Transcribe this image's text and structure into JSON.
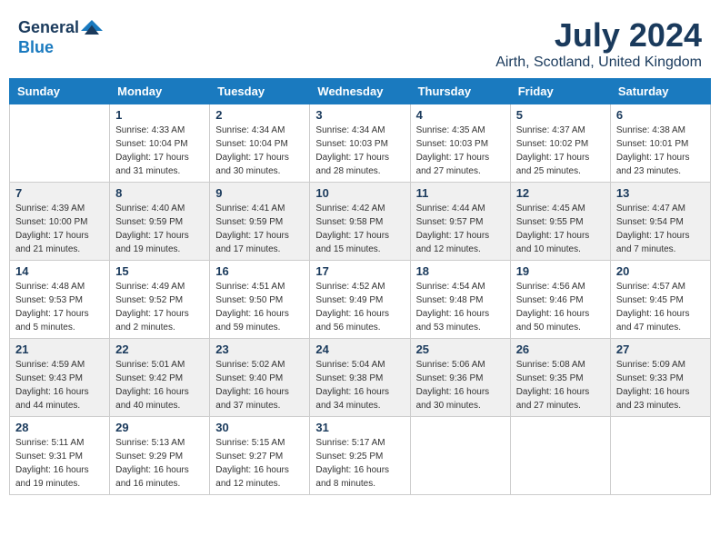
{
  "header": {
    "logo_general": "General",
    "logo_blue": "Blue",
    "month_year": "July 2024",
    "location": "Airth, Scotland, United Kingdom"
  },
  "calendar": {
    "days_of_week": [
      "Sunday",
      "Monday",
      "Tuesday",
      "Wednesday",
      "Thursday",
      "Friday",
      "Saturday"
    ],
    "weeks": [
      [
        {
          "day": "",
          "sunrise": "",
          "sunset": "",
          "daylight": ""
        },
        {
          "day": "1",
          "sunrise": "Sunrise: 4:33 AM",
          "sunset": "Sunset: 10:04 PM",
          "daylight": "Daylight: 17 hours and 31 minutes."
        },
        {
          "day": "2",
          "sunrise": "Sunrise: 4:34 AM",
          "sunset": "Sunset: 10:04 PM",
          "daylight": "Daylight: 17 hours and 30 minutes."
        },
        {
          "day": "3",
          "sunrise": "Sunrise: 4:34 AM",
          "sunset": "Sunset: 10:03 PM",
          "daylight": "Daylight: 17 hours and 28 minutes."
        },
        {
          "day": "4",
          "sunrise": "Sunrise: 4:35 AM",
          "sunset": "Sunset: 10:03 PM",
          "daylight": "Daylight: 17 hours and 27 minutes."
        },
        {
          "day": "5",
          "sunrise": "Sunrise: 4:37 AM",
          "sunset": "Sunset: 10:02 PM",
          "daylight": "Daylight: 17 hours and 25 minutes."
        },
        {
          "day": "6",
          "sunrise": "Sunrise: 4:38 AM",
          "sunset": "Sunset: 10:01 PM",
          "daylight": "Daylight: 17 hours and 23 minutes."
        }
      ],
      [
        {
          "day": "7",
          "sunrise": "Sunrise: 4:39 AM",
          "sunset": "Sunset: 10:00 PM",
          "daylight": "Daylight: 17 hours and 21 minutes."
        },
        {
          "day": "8",
          "sunrise": "Sunrise: 4:40 AM",
          "sunset": "Sunset: 9:59 PM",
          "daylight": "Daylight: 17 hours and 19 minutes."
        },
        {
          "day": "9",
          "sunrise": "Sunrise: 4:41 AM",
          "sunset": "Sunset: 9:59 PM",
          "daylight": "Daylight: 17 hours and 17 minutes."
        },
        {
          "day": "10",
          "sunrise": "Sunrise: 4:42 AM",
          "sunset": "Sunset: 9:58 PM",
          "daylight": "Daylight: 17 hours and 15 minutes."
        },
        {
          "day": "11",
          "sunrise": "Sunrise: 4:44 AM",
          "sunset": "Sunset: 9:57 PM",
          "daylight": "Daylight: 17 hours and 12 minutes."
        },
        {
          "day": "12",
          "sunrise": "Sunrise: 4:45 AM",
          "sunset": "Sunset: 9:55 PM",
          "daylight": "Daylight: 17 hours and 10 minutes."
        },
        {
          "day": "13",
          "sunrise": "Sunrise: 4:47 AM",
          "sunset": "Sunset: 9:54 PM",
          "daylight": "Daylight: 17 hours and 7 minutes."
        }
      ],
      [
        {
          "day": "14",
          "sunrise": "Sunrise: 4:48 AM",
          "sunset": "Sunset: 9:53 PM",
          "daylight": "Daylight: 17 hours and 5 minutes."
        },
        {
          "day": "15",
          "sunrise": "Sunrise: 4:49 AM",
          "sunset": "Sunset: 9:52 PM",
          "daylight": "Daylight: 17 hours and 2 minutes."
        },
        {
          "day": "16",
          "sunrise": "Sunrise: 4:51 AM",
          "sunset": "Sunset: 9:50 PM",
          "daylight": "Daylight: 16 hours and 59 minutes."
        },
        {
          "day": "17",
          "sunrise": "Sunrise: 4:52 AM",
          "sunset": "Sunset: 9:49 PM",
          "daylight": "Daylight: 16 hours and 56 minutes."
        },
        {
          "day": "18",
          "sunrise": "Sunrise: 4:54 AM",
          "sunset": "Sunset: 9:48 PM",
          "daylight": "Daylight: 16 hours and 53 minutes."
        },
        {
          "day": "19",
          "sunrise": "Sunrise: 4:56 AM",
          "sunset": "Sunset: 9:46 PM",
          "daylight": "Daylight: 16 hours and 50 minutes."
        },
        {
          "day": "20",
          "sunrise": "Sunrise: 4:57 AM",
          "sunset": "Sunset: 9:45 PM",
          "daylight": "Daylight: 16 hours and 47 minutes."
        }
      ],
      [
        {
          "day": "21",
          "sunrise": "Sunrise: 4:59 AM",
          "sunset": "Sunset: 9:43 PM",
          "daylight": "Daylight: 16 hours and 44 minutes."
        },
        {
          "day": "22",
          "sunrise": "Sunrise: 5:01 AM",
          "sunset": "Sunset: 9:42 PM",
          "daylight": "Daylight: 16 hours and 40 minutes."
        },
        {
          "day": "23",
          "sunrise": "Sunrise: 5:02 AM",
          "sunset": "Sunset: 9:40 PM",
          "daylight": "Daylight: 16 hours and 37 minutes."
        },
        {
          "day": "24",
          "sunrise": "Sunrise: 5:04 AM",
          "sunset": "Sunset: 9:38 PM",
          "daylight": "Daylight: 16 hours and 34 minutes."
        },
        {
          "day": "25",
          "sunrise": "Sunrise: 5:06 AM",
          "sunset": "Sunset: 9:36 PM",
          "daylight": "Daylight: 16 hours and 30 minutes."
        },
        {
          "day": "26",
          "sunrise": "Sunrise: 5:08 AM",
          "sunset": "Sunset: 9:35 PM",
          "daylight": "Daylight: 16 hours and 27 minutes."
        },
        {
          "day": "27",
          "sunrise": "Sunrise: 5:09 AM",
          "sunset": "Sunset: 9:33 PM",
          "daylight": "Daylight: 16 hours and 23 minutes."
        }
      ],
      [
        {
          "day": "28",
          "sunrise": "Sunrise: 5:11 AM",
          "sunset": "Sunset: 9:31 PM",
          "daylight": "Daylight: 16 hours and 19 minutes."
        },
        {
          "day": "29",
          "sunrise": "Sunrise: 5:13 AM",
          "sunset": "Sunset: 9:29 PM",
          "daylight": "Daylight: 16 hours and 16 minutes."
        },
        {
          "day": "30",
          "sunrise": "Sunrise: 5:15 AM",
          "sunset": "Sunset: 9:27 PM",
          "daylight": "Daylight: 16 hours and 12 minutes."
        },
        {
          "day": "31",
          "sunrise": "Sunrise: 5:17 AM",
          "sunset": "Sunset: 9:25 PM",
          "daylight": "Daylight: 16 hours and 8 minutes."
        },
        {
          "day": "",
          "sunrise": "",
          "sunset": "",
          "daylight": ""
        },
        {
          "day": "",
          "sunrise": "",
          "sunset": "",
          "daylight": ""
        },
        {
          "day": "",
          "sunrise": "",
          "sunset": "",
          "daylight": ""
        }
      ]
    ]
  }
}
